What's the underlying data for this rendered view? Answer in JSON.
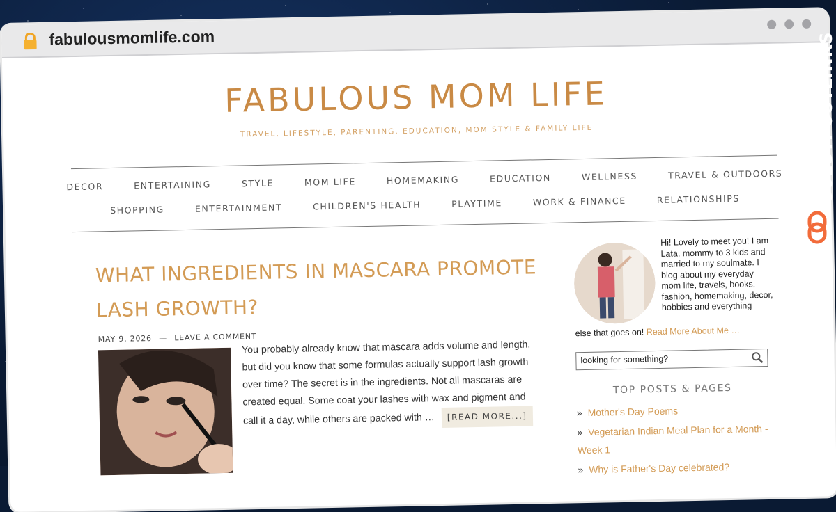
{
  "browser": {
    "url": "fabulousmomlife.com"
  },
  "site": {
    "title": "FABULOUS MOM LIFE",
    "tagline": "TRAVEL, LIFESTYLE, PARENTING, EDUCATION, MOM STYLE & FAMILY LIFE"
  },
  "nav": {
    "row1": [
      "DECOR",
      "ENTERTAINING",
      "STYLE",
      "MOM LIFE",
      "HOMEMAKING",
      "EDUCATION",
      "WELLNESS",
      "TRAVEL & OUTDOORS"
    ],
    "row2": [
      "SHOPPING",
      "ENTERTAINMENT",
      "CHILDREN'S HEALTH",
      "PLAYTIME",
      "WORK & FINANCE",
      "RELATIONSHIPS"
    ]
  },
  "post": {
    "title": "WHAT INGREDIENTS IN MASCARA PROMOTE LASH GROWTH?",
    "date": "MAY 9, 2026",
    "separator": "—",
    "comment_link": "LEAVE A COMMENT",
    "excerpt": "You probably already know that mascara adds volume and length, but did you know that some formulas actually support lash growth over time? The secret is in the ingredients. Not all mascaras are created equal. Some coat your lashes with wax and pigment and call it a day, while others are packed with …",
    "read_more": "[READ MORE...]"
  },
  "sidebar": {
    "about_text": "Hi! Lovely to meet you! I am Lata, mommy to 3 kids and married to my soulmate. I blog about my everyday mom life, travels, books, fashion, homemaking, decor, hobbies and everything",
    "about_tail": "else that goes on!",
    "about_link": "Read More About Me …",
    "search_value": "looking for something?",
    "top_posts_title": "TOP POSTS & PAGES",
    "top_posts": [
      {
        "bullet": "»",
        "label": "Mother's Day Poems"
      },
      {
        "bullet": "»",
        "label": "Vegetarian Indian Meal Plan for a Month - Week 1"
      },
      {
        "bullet": "»",
        "label": "Why is Father's Day celebrated?"
      }
    ]
  },
  "watermark": {
    "text": "GUESTPOSTLINKS"
  },
  "colors": {
    "accent": "#d39b55",
    "title": "#c98a45",
    "nav_text": "#555555",
    "watermark_logo": "#f26b3a"
  }
}
